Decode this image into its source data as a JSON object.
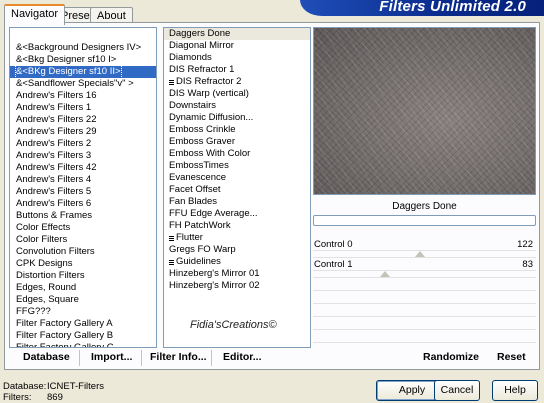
{
  "header": {
    "title": "Filters Unlimited 2.0"
  },
  "tabs": [
    {
      "label": "Navigator",
      "active": true
    },
    {
      "label": "Presets",
      "active": false
    },
    {
      "label": "About",
      "active": false
    }
  ],
  "categories": [
    {
      "label": "&<Background Designers IV>",
      "selected": false
    },
    {
      "label": "&<Bkg Designer sf10 I>",
      "selected": false
    },
    {
      "label": "&<BKg Designer sf10 II>",
      "selected": true
    },
    {
      "label": "&<Sandflower Specials\"v\" >",
      "selected": false
    },
    {
      "label": "Andrew's Filters 16",
      "selected": false
    },
    {
      "label": "Andrew's Filters 1",
      "selected": false
    },
    {
      "label": "Andrew's Filters 22",
      "selected": false
    },
    {
      "label": "Andrew's Filters 29",
      "selected": false
    },
    {
      "label": "Andrew's Filters 2",
      "selected": false
    },
    {
      "label": "Andrew's Filters 3",
      "selected": false
    },
    {
      "label": "Andrew's Filters 42",
      "selected": false
    },
    {
      "label": "Andrew's Filters 4",
      "selected": false
    },
    {
      "label": "Andrew's Filters 5",
      "selected": false
    },
    {
      "label": "Andrew's Filters 6",
      "selected": false
    },
    {
      "label": "Buttons & Frames",
      "selected": false
    },
    {
      "label": "Color Effects",
      "selected": false
    },
    {
      "label": "Color Filters",
      "selected": false
    },
    {
      "label": "Convolution Filters",
      "selected": false
    },
    {
      "label": "CPK Designs",
      "selected": false
    },
    {
      "label": "Distortion Filters",
      "selected": false
    },
    {
      "label": "Edges, Round",
      "selected": false
    },
    {
      "label": "Edges, Square",
      "selected": false
    },
    {
      "label": "FFG???",
      "selected": false
    },
    {
      "label": "Filter Factory Gallery A",
      "selected": false
    },
    {
      "label": "Filter Factory Gallery B",
      "selected": false
    },
    {
      "label": "Filter Factory Gallery C",
      "selected": false
    }
  ],
  "filters": [
    {
      "label": "Daggers Done",
      "highlighted": true,
      "group": false
    },
    {
      "label": "Diagonal Mirror",
      "highlighted": false,
      "group": false
    },
    {
      "label": "Diamonds",
      "highlighted": false,
      "group": false
    },
    {
      "label": "DIS Refractor 1",
      "highlighted": false,
      "group": false
    },
    {
      "label": "DIS Refractor 2",
      "highlighted": false,
      "group": true
    },
    {
      "label": "DIS Warp (vertical)",
      "highlighted": false,
      "group": false
    },
    {
      "label": "Downstairs",
      "highlighted": false,
      "group": false
    },
    {
      "label": "Dynamic Diffusion...",
      "highlighted": false,
      "group": false
    },
    {
      "label": "Emboss Crinkle",
      "highlighted": false,
      "group": false
    },
    {
      "label": "Emboss Graver",
      "highlighted": false,
      "group": false
    },
    {
      "label": "Emboss With Color",
      "highlighted": false,
      "group": false
    },
    {
      "label": "EmbossTimes",
      "highlighted": false,
      "group": false
    },
    {
      "label": "Evanescence",
      "highlighted": false,
      "group": false
    },
    {
      "label": "Facet Offset",
      "highlighted": false,
      "group": false
    },
    {
      "label": "Fan Blades",
      "highlighted": false,
      "group": false
    },
    {
      "label": "FFU Edge Average...",
      "highlighted": false,
      "group": false
    },
    {
      "label": "FH PatchWork",
      "highlighted": false,
      "group": false
    },
    {
      "label": "Flutter",
      "highlighted": false,
      "group": true
    },
    {
      "label": "Gregs FO Warp",
      "highlighted": false,
      "group": false
    },
    {
      "label": "Guidelines",
      "highlighted": false,
      "group": true
    },
    {
      "label": "Hinzeberg's Mirror 01",
      "highlighted": false,
      "group": false
    },
    {
      "label": "Hinzeberg's Mirror 02",
      "highlighted": false,
      "group": false
    }
  ],
  "selected_filter_name": "Daggers Done",
  "progress": 0,
  "controls": [
    {
      "label": "Control 0",
      "value": "122",
      "fraction": 0.478
    },
    {
      "label": "Control  1",
      "value": "83",
      "fraction": 0.325
    }
  ],
  "watermark": "Fidia'sCreations©",
  "toolbar": {
    "database": "Database",
    "import": "Import...",
    "filter_info": "Filter Info...",
    "editor": "Editor...",
    "randomize": "Randomize",
    "reset": "Reset"
  },
  "footer": {
    "database_label": "Database:",
    "database_value": "ICNET-Filters",
    "filters_label": "Filters:",
    "filters_value": "869"
  },
  "buttons": {
    "apply": "Apply",
    "cancel": "Cancel",
    "help": "Help"
  },
  "colors": {
    "selection": "#316ac5",
    "header": "#0a2a8c",
    "tab_accent": "#e68b2c"
  }
}
